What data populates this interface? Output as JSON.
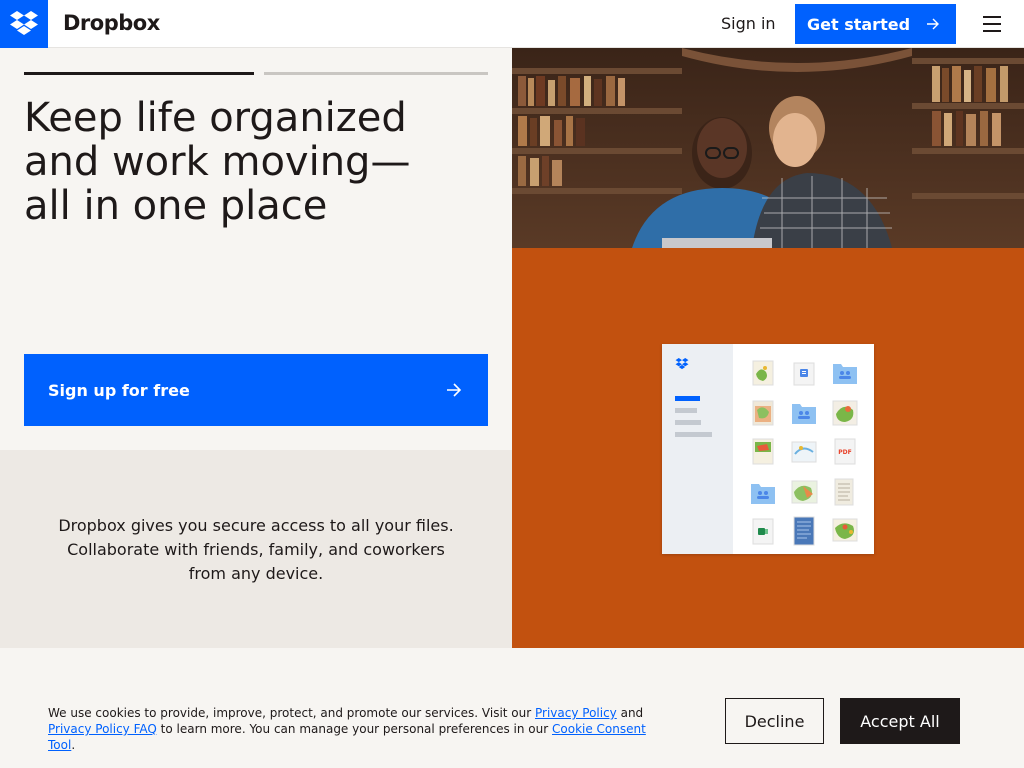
{
  "header": {
    "brand": "Dropbox",
    "logo_icon": "dropbox-logo-icon",
    "sign_in": "Sign in",
    "get_started": "Get started",
    "menu_icon": "hamburger-menu-icon"
  },
  "hero": {
    "headline_lines": [
      "Keep life organized",
      "and work moving—",
      "all in one place"
    ],
    "signup_label": "Sign up for free",
    "description_lines": [
      "Dropbox gives you secure access to all your files.",
      "Collaborate with friends, family, and coworkers",
      "from any device."
    ]
  },
  "cookie": {
    "text_before": "We use cookies to provide, improve, protect, and promote our services. Visit our ",
    "privacy_policy": "Privacy Policy",
    "and": " and ",
    "privacy_faq": "Privacy Policy FAQ",
    "text_middle": " to learn more. You can manage your personal preferences in our ",
    "consent_tool": "Cookie Consent Tool",
    "text_end": ".",
    "decline": "Decline",
    "accept": "Accept All"
  },
  "colors": {
    "accent": "#0061fe",
    "orange_panel": "#c2510f",
    "dark": "#1e1919"
  },
  "app_mock": {
    "pdf_label": "PDF"
  }
}
